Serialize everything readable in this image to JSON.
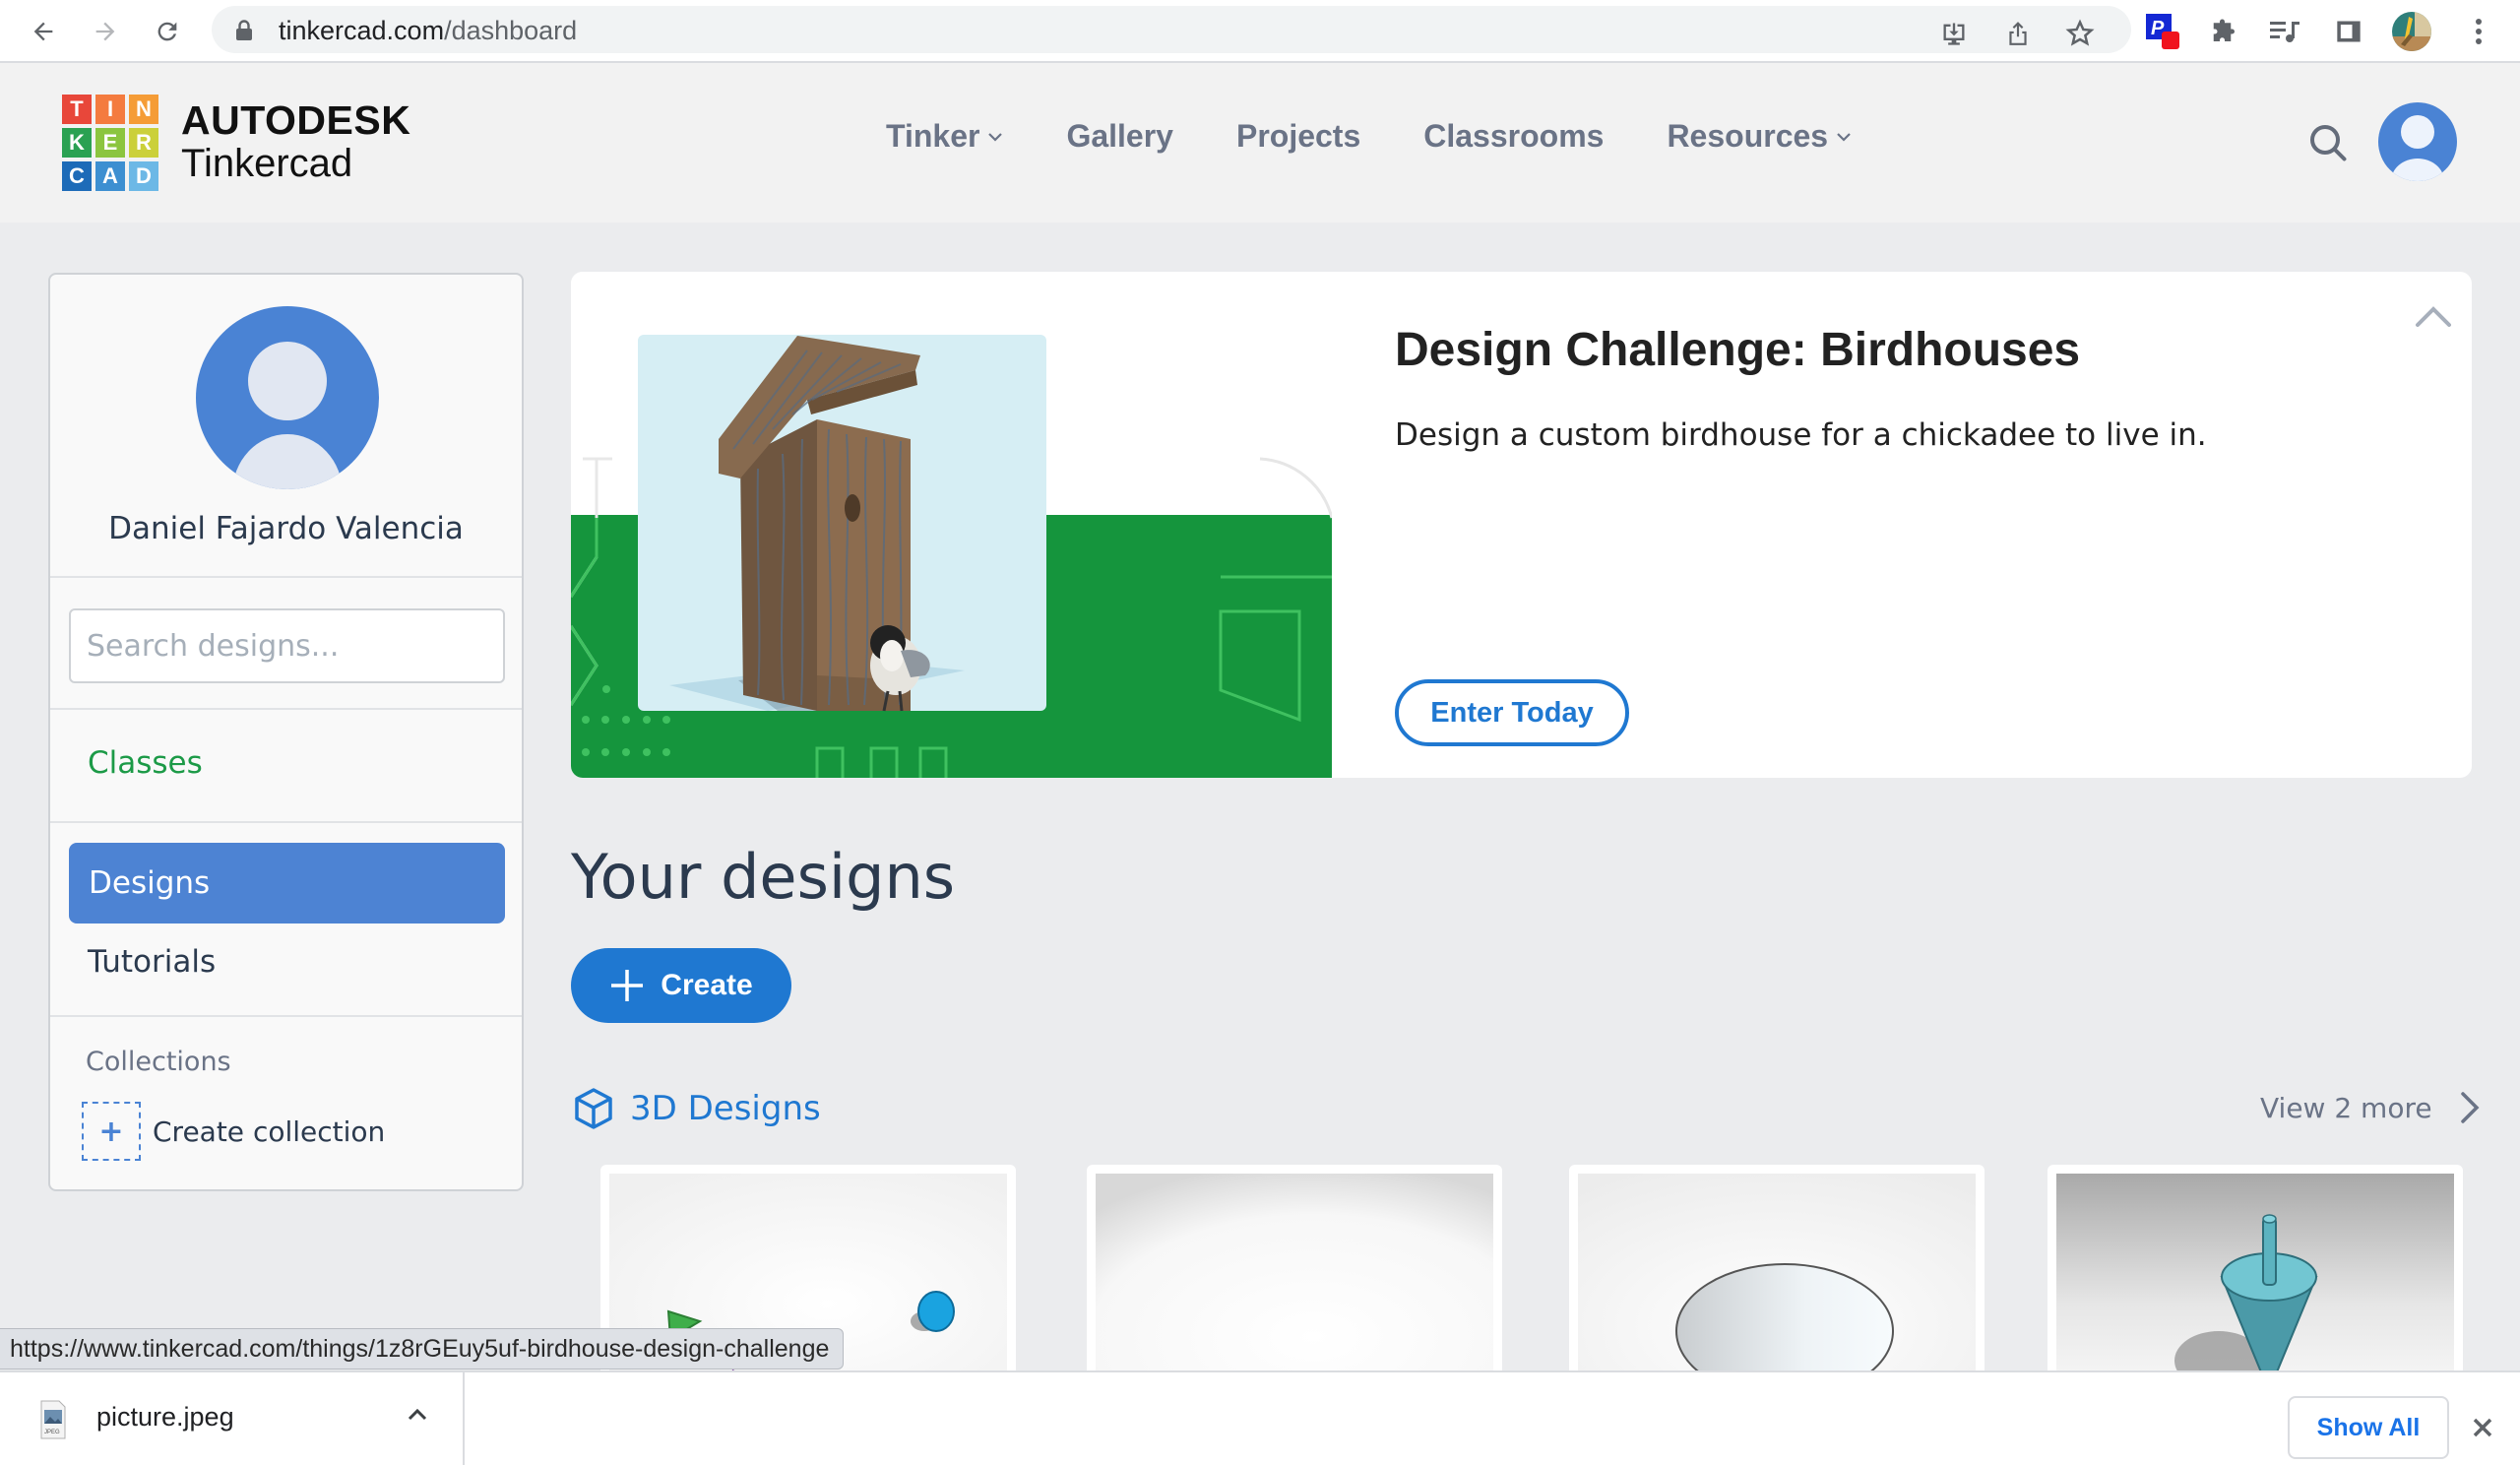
{
  "browser": {
    "url_host": "tinkercad.com",
    "url_path": "/dashboard",
    "icons": [
      "back-icon",
      "forward-icon",
      "reload-icon",
      "lock-icon",
      "install-icon",
      "share-icon",
      "bookmark-star-icon",
      "extension-p-icon",
      "extensions-puzzle-icon",
      "media-control-icon",
      "side-panel-icon",
      "profile-avatar-icon",
      "menu-kebab-icon"
    ]
  },
  "header": {
    "logo_letters": [
      "T",
      "I",
      "N",
      "K",
      "E",
      "R",
      "C",
      "A",
      "D"
    ],
    "logo_colors": [
      "#e8473a",
      "#f47b3f",
      "#f59c36",
      "#2aa152",
      "#8bc53f",
      "#cbd03a",
      "#1d6bb8",
      "#3d8fd1",
      "#6cb8e6"
    ],
    "brand_top": "AUTODESK",
    "brand_bottom": "Tinkercad",
    "nav": [
      {
        "label": "Tinker",
        "has_dropdown": true
      },
      {
        "label": "Gallery",
        "has_dropdown": false
      },
      {
        "label": "Projects",
        "has_dropdown": false
      },
      {
        "label": "Classrooms",
        "has_dropdown": false
      },
      {
        "label": "Resources",
        "has_dropdown": true
      }
    ]
  },
  "sidebar": {
    "user_name": "Daniel Fajardo Valencia",
    "search_placeholder": "Search designs...",
    "items": [
      {
        "label": "Classes",
        "color": "#1c9a47"
      },
      {
        "label": "Designs",
        "active": true
      },
      {
        "label": "Tutorials"
      }
    ],
    "collections_heading": "Collections",
    "create_collection_label": "Create collection"
  },
  "banner": {
    "title": "Design Challenge: Birdhouses",
    "description": "Design a custom birdhouse for a chickadee to live in.",
    "button_label": "Enter Today"
  },
  "main": {
    "heading": "Your designs",
    "create_label": "Create",
    "section_label": "3D Designs",
    "view_more_label": "View 2 more",
    "cards": [
      {
        "thumb": "colorful-shapes"
      },
      {
        "thumb": "blank"
      },
      {
        "thumb": "white-dome"
      },
      {
        "thumb": "teal-spinning-top"
      }
    ]
  },
  "status_url": "https://www.tinkercad.com/things/1z8rGEuy5uf-birdhouse-design-challenge",
  "download_shelf": {
    "file_name": "picture.jpeg",
    "show_all_label": "Show All"
  },
  "colors": {
    "accent_blue": "#1f78d1",
    "sidebar_active": "#4d83d3",
    "classes_green": "#1c9a47",
    "banner_green": "#15953d"
  }
}
